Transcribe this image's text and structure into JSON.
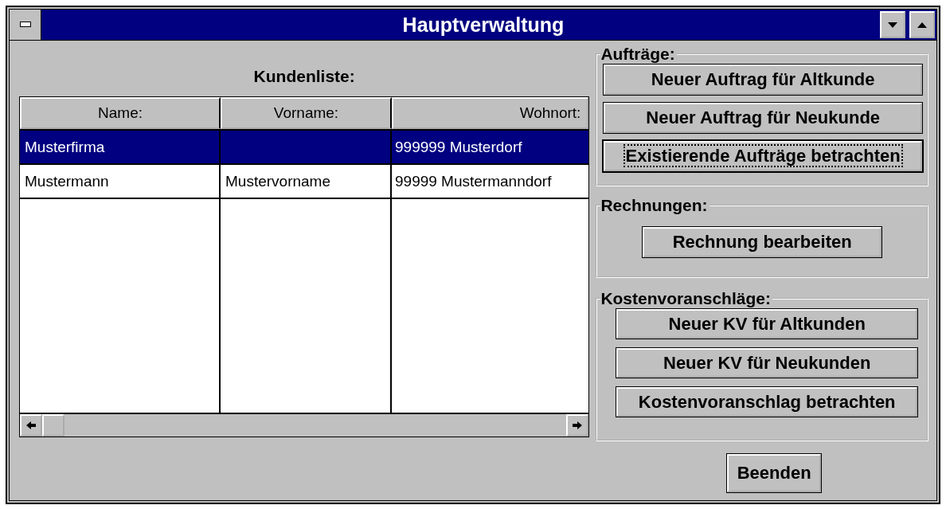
{
  "window": {
    "title": "Hauptverwaltung"
  },
  "customer_list": {
    "title": "Kundenliste:",
    "columns": [
      {
        "label": "Name:"
      },
      {
        "label": "Vorname:"
      },
      {
        "label": "Wohnort:"
      }
    ],
    "rows": [
      {
        "selected": true,
        "cells": [
          "Musterfirma",
          "",
          "999999 Musterdorf"
        ]
      },
      {
        "selected": false,
        "cells": [
          "Mustermann",
          "Mustervorname",
          "99999 Mustermanndorf"
        ]
      }
    ]
  },
  "groups": [
    {
      "title": "Aufträge:",
      "buttons": [
        {
          "label": "Neuer Auftrag für Altkunde",
          "focused": false
        },
        {
          "label": "Neuer Auftrag für Neukunde",
          "focused": false
        },
        {
          "label": "Existierende Aufträge betrachten",
          "focused": true
        }
      ]
    },
    {
      "title": "Rechnungen:",
      "buttons": [
        {
          "label": "Rechnung bearbeiten",
          "focused": false
        }
      ]
    },
    {
      "title": "Kostenvoranschläge:",
      "buttons": [
        {
          "label": "Neuer KV für Altkunden",
          "focused": false
        },
        {
          "label": "Neuer KV für Neukunden",
          "focused": false
        },
        {
          "label": "Kostenvoranschlag betrachten",
          "focused": false
        }
      ]
    }
  ],
  "exit_button": {
    "label": "Beenden"
  }
}
